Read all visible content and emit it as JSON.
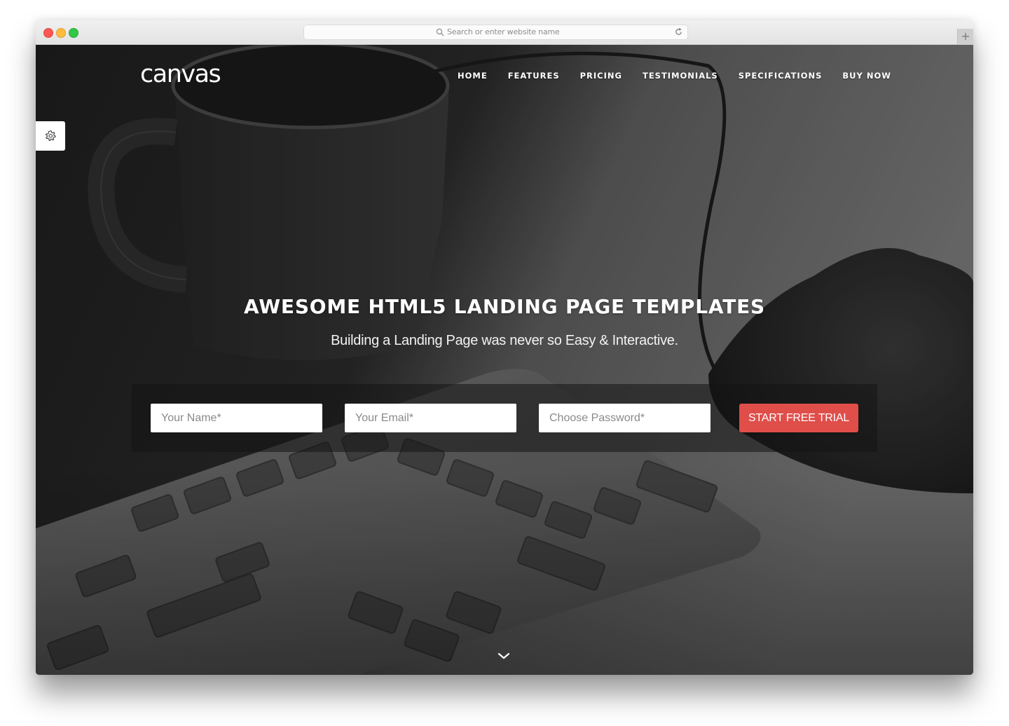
{
  "browser": {
    "window_controls": [
      "close",
      "minimize",
      "maximize"
    ],
    "address_bar": {
      "placeholder": "Search or enter website name",
      "value": ""
    },
    "icons": {
      "search": "search-icon",
      "reload": "reload-icon",
      "new_tab": "plus-icon"
    },
    "new_tab_label": "+"
  },
  "site": {
    "logo": "canvas",
    "nav": [
      {
        "label": "HOME"
      },
      {
        "label": "FEATURES"
      },
      {
        "label": "PRICING"
      },
      {
        "label": "TESTIMONIALS"
      },
      {
        "label": "SPECIFICATIONS"
      },
      {
        "label": "BUY NOW"
      }
    ],
    "settings_icon": "gear-icon",
    "hero": {
      "title": "AWESOME HTML5 LANDING PAGE TEMPLATES",
      "subtitle": "Building a Landing Page was never so Easy & Interactive."
    },
    "signup_form": {
      "name_placeholder": "Your Name*",
      "email_placeholder": "Your Email*",
      "password_placeholder": "Choose Password*",
      "submit_label": "START FREE TRIAL"
    },
    "scroll_icon": "chevron-down-icon"
  },
  "colors": {
    "cta": "#e04e4a",
    "traffic_red": "#fc5753",
    "traffic_yellow": "#fdbc40",
    "traffic_green": "#33c748"
  }
}
